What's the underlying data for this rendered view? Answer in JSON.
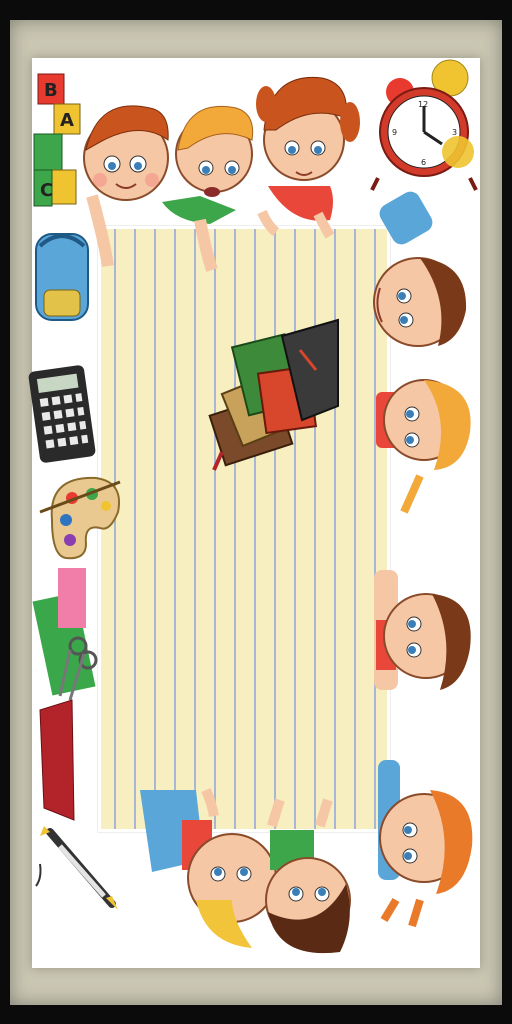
{
  "blocks": {
    "letters": [
      "B",
      "A",
      "C"
    ]
  },
  "clock": {
    "numerals": [
      "12",
      "3",
      "6",
      "9"
    ]
  }
}
